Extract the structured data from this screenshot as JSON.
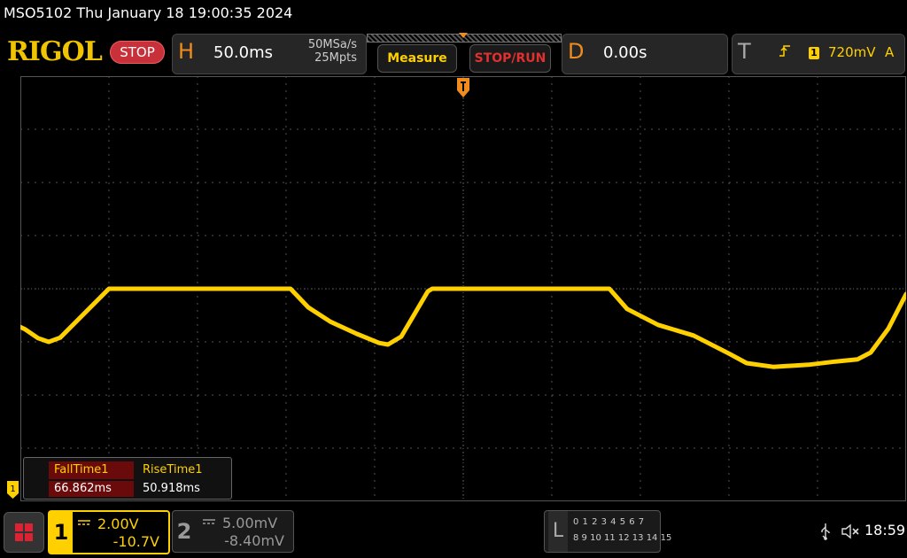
{
  "title_bar": {
    "text": "MSO5102  Thu January 18 19:00:35 2024"
  },
  "header": {
    "logo": "RIGOL",
    "run_state": "STOP",
    "horizontal": {
      "letter": "H",
      "timebase": "50.0ms",
      "sample_rate": "50MSa/s",
      "memory_depth": "25Mpts"
    },
    "measure_label": "Measure",
    "stoprun_label": "STOP/RUN",
    "delay": {
      "letter": "D",
      "value": "0.00s"
    },
    "trigger": {
      "letter": "T",
      "source": "1",
      "level": "720mV",
      "mode": "A"
    }
  },
  "measurements": [
    {
      "name": "FallTime1",
      "value": "66.862ms"
    },
    {
      "name": "RiseTime1",
      "value": "50.918ms"
    }
  ],
  "channels": [
    {
      "number": "1",
      "scale": "2.00V",
      "offset": "-10.7V",
      "active": true,
      "color": "#ffd000"
    },
    {
      "number": "2",
      "scale": "5.00mV",
      "offset": "-8.40mV",
      "active": false,
      "color": "#999999"
    }
  ],
  "logic_analyzer": {
    "letter": "L",
    "row1": "0 1 2 3  4 5 6 7",
    "row2": "8 9 10 11 12 13 14 15"
  },
  "status": {
    "clock": "18:59"
  },
  "colors": {
    "ch1": "#ffd000",
    "accent_orange": "#f08c1e",
    "stop_red": "#c8303a"
  },
  "chart_data": {
    "type": "line",
    "x_divisions": 10,
    "y_divisions": 8,
    "series": [
      {
        "name": "1",
        "color": "#ffd000",
        "trace_shape": "periodic trapezoid: rise, flat high, falling curve, repeated; ends with a slow fall and a sharp rise"
      }
    ]
  }
}
